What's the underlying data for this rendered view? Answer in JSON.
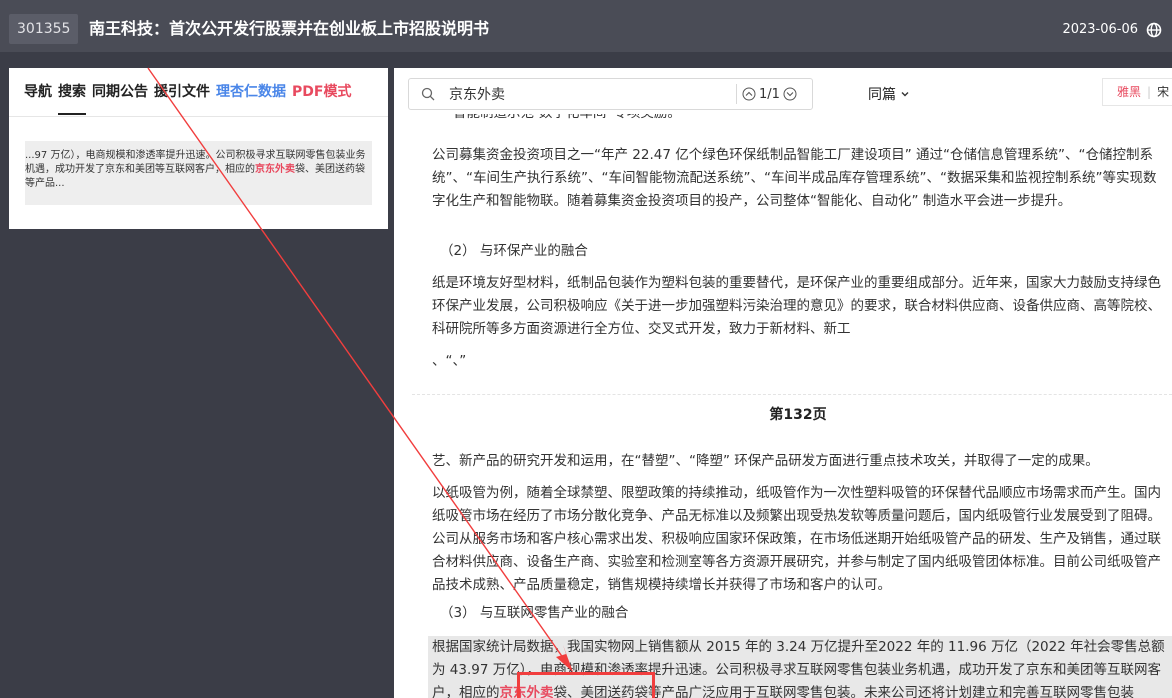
{
  "header": {
    "code": "301355",
    "title": "南王科技：首次公开发行股票并在创业板上市招股说明书",
    "date": "2023-06-06"
  },
  "left_panel": {
    "tabs": [
      {
        "label": "导航"
      },
      {
        "label": "搜索"
      },
      {
        "label": "同期公告"
      },
      {
        "label": "援引文件"
      },
      {
        "label": "理杏仁数据"
      },
      {
        "label": "PDF模式"
      }
    ],
    "result": {
      "before": "...97 万亿），电商规模和渗透率提升迅速。公司积极寻求互联网零售包装业务机遇，成功开发了京东和美团等互联网客户，相应的",
      "highlight": "京东外卖",
      "after": "袋、美团送药袋等产品..."
    }
  },
  "toolbar": {
    "search_value": "京东外卖",
    "match_count": "1/1",
    "scope_label": "同篇",
    "font_active": "雅黑",
    "font_other": "宋"
  },
  "document": {
    "cut_line": "“智能制造示范-数字化车间”专项奖励。",
    "p1": "公司募集资金投资项目之一“年产 22.47 亿个绿色环保纸制品智能工厂建设项目” 通过“仓储信息管理系统”、“仓储控制系统”、“车间生产执行系统”、“车间智能物流配送系统”、“车间半成品库存管理系统”、“数据采集和监视控制系统”等实现数字化生产和智能物联。随着募集资金投资项目的投产，公司整体“智能化、自动化” 制造水平会进一步提升。",
    "h2": "（2） 与环保产业的融合",
    "p2": "纸是环境友好型材料，纸制品包装作为塑料包装的重要替代，是环保产业的重要组成部分。近年来，国家大力鼓励支持绿色环保产业发展，公司积极响应《关于进一步加强塑料污染治理的意见》的要求，联合材料供应商、设备供应商、高等院校、科研院所等多方面资源进行全方位、交叉式开发，致力于新材料、新工",
    "marks": "、“、”",
    "page_label": "第132页",
    "p3": "艺、新产品的研究开发和运用，在“替塑”、“降塑” 环保产品研发方面进行重点技术攻关，并取得了一定的成果。",
    "p4": "以纸吸管为例，随着全球禁塑、限塑政策的持续推动，纸吸管作为一次性塑料吸管的环保替代品顺应市场需求而产生。国内纸吸管市场在经历了市场分散化竞争、产品无标准以及频繁出现受热发软等质量问题后，国内纸吸管行业发展受到了阻碍。公司从服务市场和客户核心需求出发、积极响应国家环保政策，在市场低迷期开始纸吸管产品的研发、生产及销售，通过联合材料供应商、设备生产商、实验室和检测室等各方资源开展研究，并参与制定了国内纸吸管团体标准。目前公司纸吸管产品技术成熟、产品质量稳定，销售规模持续增长并获得了市场和客户的认可。",
    "h3": "（3） 与互联网零售产业的融合",
    "p5_before": "根据国家统计局数据，我国实物网上销售额从 2015 年的 3.24 万亿提升至2022 年的 11.96 万亿（2022 年社会零售总额为 43.97 万亿），电商规模和渗透率提升迅速。公司积极寻求互联网零售包装业务机遇，成功开发了京东和美团等互联网客户，相应的",
    "p5_highlight": "京东外卖",
    "p5_after": "袋、美团送药袋等产品广泛应用于互联网零售包装。未来公司还将计划建立和完善互联网零售包装"
  },
  "colors": {
    "header_bg": "#4a4c56",
    "highlight": "#e84a5f",
    "link_blue": "#4a86e8",
    "annotation_red": "#f13e3e"
  }
}
